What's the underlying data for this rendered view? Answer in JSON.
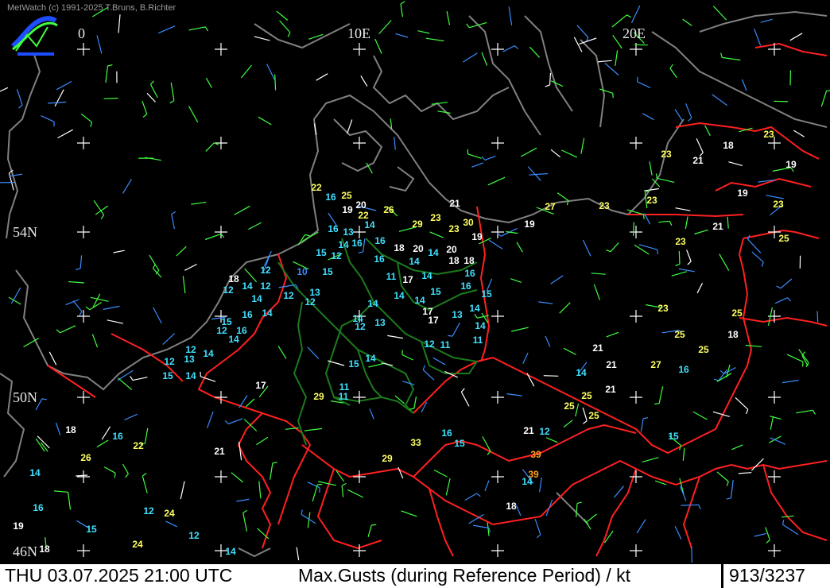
{
  "app": {
    "credit": "MetWatch  (c) 1991-2025 T.Bruns, B.Richter"
  },
  "map": {
    "longitude_labels": [
      "0",
      "10E",
      "20E"
    ],
    "latitude_labels": [
      "54N",
      "50N",
      "46N"
    ],
    "colors": {
      "background": "#000000",
      "coastline": "#808080",
      "border": "#ff2020",
      "state_border": "#1c7a1c",
      "grid_cross": "#ffffff",
      "value_cyan": "#40e0ff",
      "value_white": "#ffffff",
      "value_yellow": "#ffff60",
      "value_orange": "#ffa020",
      "wind_green": "#40ff40",
      "wind_blue": "#3a8cff",
      "wind_white": "#ffffff"
    },
    "gust_values": [
      {
        "v": "22",
        "c": "yellow"
      },
      {
        "v": "25",
        "c": "yellow"
      },
      {
        "v": "20",
        "c": "white"
      },
      {
        "v": "16",
        "c": "cyan"
      },
      {
        "v": "19",
        "c": "white"
      },
      {
        "v": "22",
        "c": "yellow"
      },
      {
        "v": "26",
        "c": "yellow"
      },
      {
        "v": "21",
        "c": "white"
      },
      {
        "v": "23",
        "c": "yellow"
      },
      {
        "v": "30",
        "c": "yellow"
      },
      {
        "v": "23",
        "c": "yellow"
      },
      {
        "v": "19",
        "c": "white"
      },
      {
        "v": "27",
        "c": "yellow"
      },
      {
        "v": "19",
        "c": "white"
      },
      {
        "v": "23",
        "c": "yellow"
      },
      {
        "v": "23",
        "c": "yellow"
      },
      {
        "v": "23",
        "c": "yellow"
      },
      {
        "v": "21",
        "c": "white"
      },
      {
        "v": "18",
        "c": "white"
      },
      {
        "v": "23",
        "c": "yellow"
      },
      {
        "v": "19",
        "c": "white"
      },
      {
        "v": "19",
        "c": "white"
      },
      {
        "v": "23",
        "c": "yellow"
      },
      {
        "v": "21",
        "c": "white"
      },
      {
        "v": "25",
        "c": "yellow"
      },
      {
        "v": "23",
        "c": "yellow"
      },
      {
        "v": "16",
        "c": "cyan"
      },
      {
        "v": "13",
        "c": "cyan"
      },
      {
        "v": "14",
        "c": "cyan"
      },
      {
        "v": "29",
        "c": "yellow"
      },
      {
        "v": "14",
        "c": "cyan"
      },
      {
        "v": "16",
        "c": "cyan"
      },
      {
        "v": "16",
        "c": "cyan"
      },
      {
        "v": "18",
        "c": "white"
      },
      {
        "v": "20",
        "c": "white"
      },
      {
        "v": "14",
        "c": "cyan"
      },
      {
        "v": "20",
        "c": "white"
      },
      {
        "v": "15",
        "c": "cyan"
      },
      {
        "v": "12",
        "c": "cyan"
      },
      {
        "v": "16",
        "c": "cyan"
      },
      {
        "v": "14",
        "c": "cyan"
      },
      {
        "v": "18",
        "c": "white"
      },
      {
        "v": "18",
        "c": "white"
      },
      {
        "v": "12",
        "c": "cyan"
      },
      {
        "v": "10",
        "c": "blue"
      },
      {
        "v": "15",
        "c": "cyan"
      },
      {
        "v": "11",
        "c": "cyan"
      },
      {
        "v": "17",
        "c": "white"
      },
      {
        "v": "14",
        "c": "cyan"
      },
      {
        "v": "16",
        "c": "cyan"
      },
      {
        "v": "18",
        "c": "white"
      },
      {
        "v": "14",
        "c": "cyan"
      },
      {
        "v": "12",
        "c": "cyan"
      },
      {
        "v": "12",
        "c": "cyan"
      },
      {
        "v": "14",
        "c": "cyan"
      },
      {
        "v": "12",
        "c": "cyan"
      },
      {
        "v": "13",
        "c": "cyan"
      },
      {
        "v": "12",
        "c": "cyan"
      },
      {
        "v": "14",
        "c": "cyan"
      },
      {
        "v": "14",
        "c": "cyan"
      },
      {
        "v": "14",
        "c": "cyan"
      },
      {
        "v": "15",
        "c": "cyan"
      },
      {
        "v": "16",
        "c": "cyan"
      },
      {
        "v": "15",
        "c": "cyan"
      },
      {
        "v": "14",
        "c": "cyan"
      },
      {
        "v": "16",
        "c": "cyan"
      },
      {
        "v": "14",
        "c": "cyan"
      },
      {
        "v": "17",
        "c": "white"
      },
      {
        "v": "13",
        "c": "cyan"
      },
      {
        "v": "17",
        "c": "white"
      },
      {
        "v": "15",
        "c": "cyan"
      },
      {
        "v": "14",
        "c": "cyan"
      },
      {
        "v": "12",
        "c": "cyan"
      },
      {
        "v": "13",
        "c": "cyan"
      },
      {
        "v": "14",
        "c": "cyan"
      },
      {
        "v": "16",
        "c": "cyan"
      },
      {
        "v": "12",
        "c": "cyan"
      },
      {
        "v": "14",
        "c": "cyan"
      },
      {
        "v": "12",
        "c": "cyan"
      },
      {
        "v": "14",
        "c": "cyan"
      },
      {
        "v": "12",
        "c": "cyan"
      },
      {
        "v": "13",
        "c": "cyan"
      },
      {
        "v": "15",
        "c": "cyan"
      },
      {
        "v": "14",
        "c": "cyan"
      },
      {
        "v": "11",
        "c": "cyan"
      },
      {
        "v": "11",
        "c": "cyan"
      },
      {
        "v": "12",
        "c": "cyan"
      },
      {
        "v": "15",
        "c": "cyan"
      },
      {
        "v": "14",
        "c": "cyan"
      },
      {
        "v": "11",
        "c": "cyan"
      },
      {
        "v": "17",
        "c": "white"
      },
      {
        "v": "11",
        "c": "cyan"
      },
      {
        "v": "29",
        "c": "yellow"
      },
      {
        "v": "23",
        "c": "yellow"
      },
      {
        "v": "25",
        "c": "yellow"
      },
      {
        "v": "25",
        "c": "yellow"
      },
      {
        "v": "25",
        "c": "yellow"
      },
      {
        "v": "18",
        "c": "white"
      },
      {
        "v": "21",
        "c": "white"
      },
      {
        "v": "21",
        "c": "white"
      },
      {
        "v": "27",
        "c": "yellow"
      },
      {
        "v": "16",
        "c": "cyan"
      },
      {
        "v": "14",
        "c": "cyan"
      },
      {
        "v": "21",
        "c": "white"
      },
      {
        "v": "25",
        "c": "yellow"
      },
      {
        "v": "25",
        "c": "yellow"
      },
      {
        "v": "25",
        "c": "yellow"
      },
      {
        "v": "21",
        "c": "white"
      },
      {
        "v": "12",
        "c": "cyan"
      },
      {
        "v": "16",
        "c": "cyan"
      },
      {
        "v": "15",
        "c": "cyan"
      },
      {
        "v": "33",
        "c": "yellow"
      },
      {
        "v": "39",
        "c": "orange"
      },
      {
        "v": "39",
        "c": "orange"
      },
      {
        "v": "14",
        "c": "cyan"
      },
      {
        "v": "29",
        "c": "yellow"
      },
      {
        "v": "18",
        "c": "white"
      },
      {
        "v": "15",
        "c": "cyan"
      },
      {
        "v": "18",
        "c": "white"
      },
      {
        "v": "16",
        "c": "cyan"
      },
      {
        "v": "22",
        "c": "yellow"
      },
      {
        "v": "26",
        "c": "yellow"
      },
      {
        "v": "14",
        "c": "cyan"
      },
      {
        "v": "21",
        "c": "white"
      },
      {
        "v": "16",
        "c": "cyan"
      },
      {
        "v": "12",
        "c": "cyan"
      },
      {
        "v": "24",
        "c": "yellow"
      },
      {
        "v": "19",
        "c": "white"
      },
      {
        "v": "15",
        "c": "cyan"
      },
      {
        "v": "12",
        "c": "cyan"
      },
      {
        "v": "24",
        "c": "yellow"
      },
      {
        "v": "18",
        "c": "white"
      },
      {
        "v": "14",
        "c": "cyan"
      }
    ]
  },
  "status": {
    "datetime": "THU 03.07.2025 21:00 UTC",
    "parameter": "Max.Gusts (during Reference Period) / kt",
    "count": "913/3237"
  }
}
